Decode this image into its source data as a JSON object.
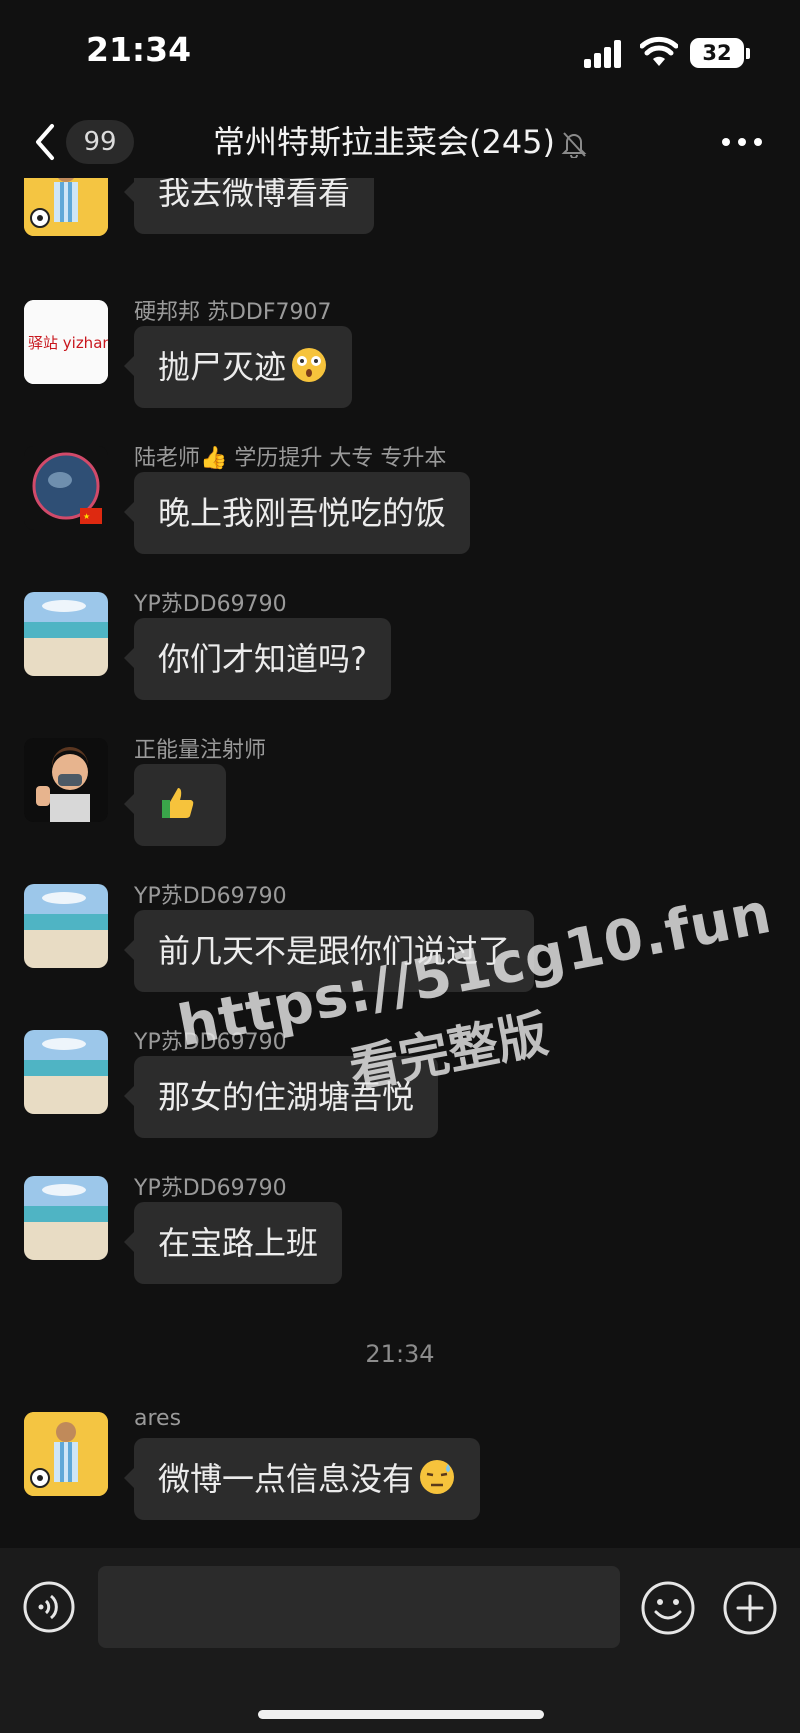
{
  "status_bar": {
    "time": "21:34",
    "battery": "32"
  },
  "nav": {
    "unread_count": "99",
    "title": "常州特斯拉韭菜会(245)"
  },
  "messages": [
    {
      "sender": "",
      "text": "我去微博看看",
      "avatar_icon": "footballer-avatar"
    },
    {
      "sender": "硬邦邦 苏DDF7907",
      "text": "抛尸灭迹",
      "emoji": "astonished-face-emoji",
      "avatar_icon": "yizhan-logo-avatar",
      "avatar_text": "驿站 yizhan"
    },
    {
      "sender": "陆老师👍 学历提升 大专 专升本",
      "text": "晚上我刚吾悦吃的饭",
      "avatar_icon": "globe-avatar"
    },
    {
      "sender": "YP苏DD69790",
      "text": "你们才知道吗?",
      "avatar_icon": "beach-avatar"
    },
    {
      "sender": "正能量注射师",
      "text": "",
      "emoji": "thumbs-up-emoji",
      "avatar_icon": "cartoon-man-avatar"
    },
    {
      "sender": "YP苏DD69790",
      "text": "前几天不是跟你们说过了",
      "avatar_icon": "beach-avatar"
    },
    {
      "sender": "YP苏DD69790",
      "text": "那女的住湖塘吾悦",
      "avatar_icon": "beach-avatar"
    },
    {
      "sender": "YP苏DD69790",
      "text": "在宝路上班",
      "avatar_icon": "beach-avatar"
    },
    {
      "sender": "ares",
      "text": "微博一点信息没有",
      "emoji": "downcast-sweat-emoji",
      "avatar_icon": "footballer-avatar"
    }
  ],
  "timestamp": "21:34",
  "watermark": {
    "url": "https://51cg10.fun",
    "caption": "看完整版"
  },
  "colors": {
    "background": "#111111",
    "bubble": "#2c2c2c",
    "input_bar": "#1b1b1b"
  }
}
